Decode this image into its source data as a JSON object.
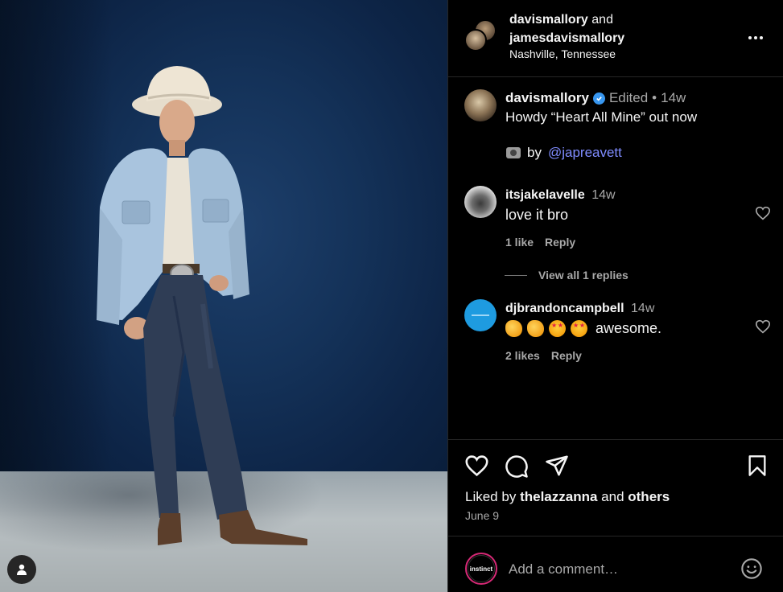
{
  "header": {
    "user1": "davismallory",
    "and": "and",
    "user2": "jamesdavismallory",
    "location": "Nashville, Tennessee"
  },
  "caption": {
    "username": "davismallory",
    "edited": "Edited",
    "sep": "•",
    "time": "14w",
    "text": "Howdy “Heart All Mine” out now",
    "by": "by",
    "handle": "@japreavett"
  },
  "comments": [
    {
      "username": "itsjakelavelle",
      "time": "14w",
      "text": "love it bro",
      "likes": "1 like",
      "reply": "Reply",
      "view_replies": "View all 1 replies"
    },
    {
      "username": "djbrandoncampbell",
      "time": "14w",
      "text": "awesome.",
      "likes": "2 likes",
      "reply": "Reply"
    }
  ],
  "footer": {
    "liked_prefix": "Liked by",
    "liked_user": "thelazzanna",
    "liked_and": "and",
    "liked_others": "others",
    "date": "June 9",
    "comment_placeholder": "Add a comment…",
    "brand_avatar": "instinct"
  },
  "icons": {
    "more": "more-horizontal-icon",
    "like": "heart-icon",
    "comment": "comment-icon",
    "share": "send-icon",
    "save": "bookmark-icon",
    "emoji": "smile-icon",
    "profile": "user-icon"
  },
  "colors": {
    "background": "#000000",
    "divider": "#262626",
    "muted": "#a8a8a8",
    "verified": "#3897f0",
    "link": "#7f8cff"
  }
}
